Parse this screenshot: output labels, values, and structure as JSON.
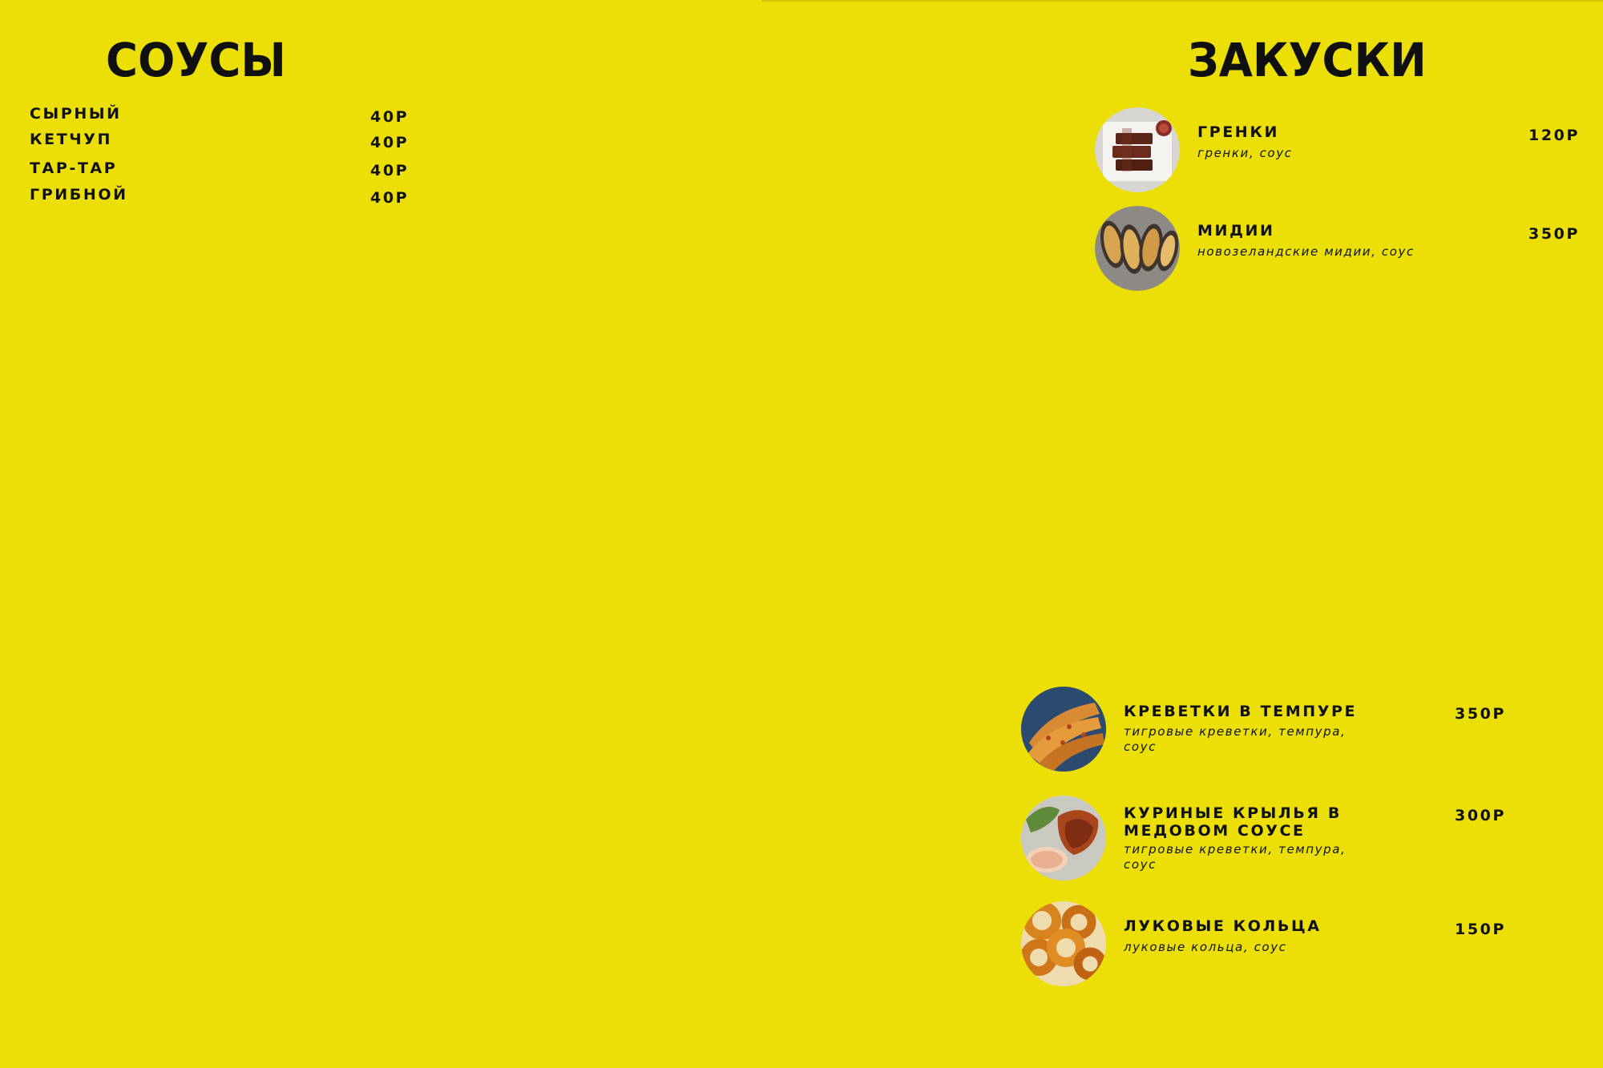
{
  "sauces": {
    "title": "СОУСЫ",
    "items": [
      {
        "name": "СЫРНЫЙ",
        "price": "40Р"
      },
      {
        "name": "КЕТЧУП",
        "price": "40Р"
      },
      {
        "name": "ТАР-ТАР",
        "price": "40Р"
      },
      {
        "name": "ГРИБНОЙ",
        "price": "40Р"
      }
    ]
  },
  "snacks": {
    "title": "ЗАКУСКИ",
    "items": [
      {
        "name": "ГРЕНКИ",
        "description": "гренки, соус",
        "price": "120Р",
        "icon": "croutons-photo-icon"
      },
      {
        "name": "МИДИИ",
        "description": "новозеландские мидии, соус",
        "price": "350Р",
        "icon": "mussels-photo-icon"
      },
      {
        "name": "КРЕВЕТКИ В ТЕМПУРЕ",
        "description": "тигровые креветки, темпура, соус",
        "price": "350Р",
        "icon": "tempura-shrimp-photo-icon"
      },
      {
        "name": "КУРИНЫЕ КРЫЛЬЯ В МЕДОВОМ СОУСЕ",
        "description": "тигровые креветки, темпура, соус",
        "price": "300Р",
        "icon": "chicken-wings-photo-icon"
      },
      {
        "name": "ЛУКОВЫЕ КОЛЬЦА",
        "description": "луковые кольца, соус",
        "price": "150Р",
        "icon": "onion-rings-photo-icon"
      }
    ]
  },
  "colors": {
    "background": "#ebdf07",
    "text": "#111111"
  }
}
